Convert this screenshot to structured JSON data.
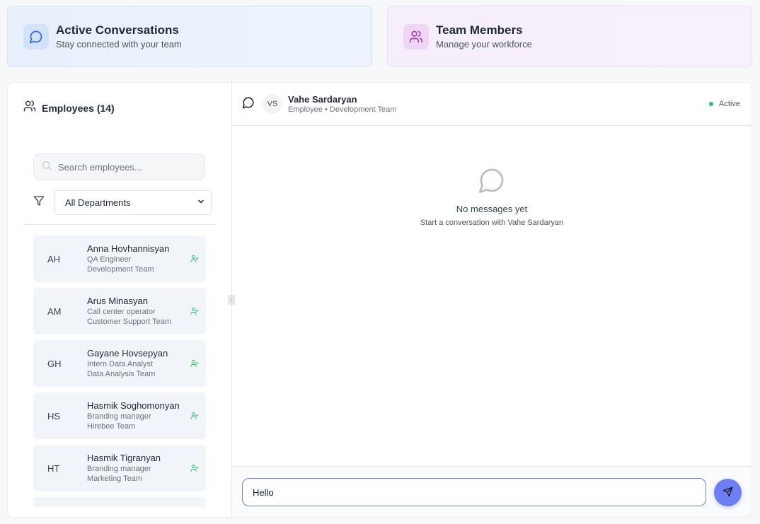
{
  "cards": {
    "conversations": {
      "title": "Active Conversations",
      "subtitle": "Stay connected with your team"
    },
    "team": {
      "title": "Team Members",
      "subtitle": "Manage your workforce"
    }
  },
  "employees": {
    "header": "Employees (14)",
    "search_placeholder": "Search employees...",
    "department_filter": "All Departments",
    "items": [
      {
        "initials": "AH",
        "name": "Anna Hovhannisyan",
        "role": "QA Engineer",
        "team": "Development Team"
      },
      {
        "initials": "AM",
        "name": "Arus Minasyan",
        "role": "Call center operator",
        "team": "Customer Support Team"
      },
      {
        "initials": "GH",
        "name": "Gayane Hovsepyan",
        "role": "Intern Data Analyst",
        "team": "Data Analysis Team"
      },
      {
        "initials": "HS",
        "name": "Hasmik Soghomonyan",
        "role": "Branding manager",
        "team": "Hirebee Team"
      },
      {
        "initials": "HT",
        "name": "Hasmik Tigranyan",
        "role": "Branding manager",
        "team": "Marketing Team"
      }
    ]
  },
  "chat": {
    "avatar_initials": "VS",
    "contact_name": "Vahe Sardaryan",
    "contact_subtitle": "Employee • Development Team",
    "status": "Active",
    "empty_title": "No messages yet",
    "empty_subtitle": "Start a conversation with Vahe Sardaryan",
    "input_value": "Hello"
  },
  "colors": {
    "accent": "#6e7ff3",
    "status_active": "#22c55e",
    "add_icon": "#22c55e"
  },
  "icons": {
    "conversations": "message-circle-icon",
    "team": "users-icon",
    "employees": "users-icon",
    "search": "search-icon",
    "filter": "filter-icon",
    "add": "user-check-icon",
    "send": "send-icon"
  }
}
